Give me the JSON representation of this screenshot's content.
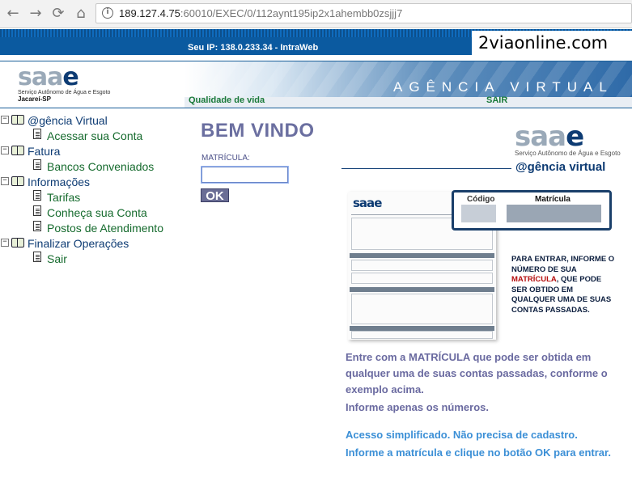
{
  "browser": {
    "url_host": "189.127.4.75",
    "url_rest": ":60010/EXEC/0/112aynt195ip2x1ahembb0zsjjj7",
    "back_icon": "←",
    "forward_icon": "→",
    "reload_icon": "⟳",
    "home_icon": "⌂"
  },
  "header": {
    "ip_text": "Seu IP: 138.0.233.34 - IntraWeb",
    "watermark": "2viaonline.com",
    "logo_word_s": "saa",
    "logo_word_e": "e",
    "logo_sub": "Serviço Autônomo de Água e Esgoto",
    "logo_city": "Jacareí-SP",
    "agencia_title": "AGÊNCIA VIRTUAL",
    "slogan": "Qualidade de vida",
    "sair_link": "SAIR"
  },
  "menu": {
    "toggle_symbol": "−",
    "groups": [
      {
        "label": "@gência Virtual",
        "items": [
          "Acessar sua Conta"
        ]
      },
      {
        "label": "Fatura",
        "items": [
          "Bancos Conveniados"
        ]
      },
      {
        "label": "Informações",
        "items": [
          "Tarifas",
          "Conheça sua Conta",
          "Postos de Atendimento"
        ]
      },
      {
        "label": "Finalizar Operações",
        "items": [
          "Sair"
        ]
      }
    ]
  },
  "login": {
    "title": "BEM VINDO",
    "label": "MATRÍCULA:",
    "input_value": "",
    "ok_label": "OK"
  },
  "right": {
    "logo_sub": "Serviço Autônomo de Água e Esgoto",
    "agencia_virtual": "@gência virtual",
    "callout_codigo": "Código",
    "callout_matricula": "Matrícula",
    "para_entrar_1": "PARA ENTRAR, INFORME O NÚMERO DE SUA ",
    "para_entrar_red": "MATRÍCULA",
    "para_entrar_2": ", QUE PODE SER OBTIDO EM QUALQUER UMA DE SUAS CONTAS PASSADAS.",
    "info_1": "Entre com a MATRÍCULA que pode ser obtida em qualquer uma de suas contas passadas, conforme o exemplo acima.",
    "info_2": "Informe apenas os números.",
    "info_3": "Acesso simplificado. Não precisa de cadastro.",
    "info_4": "Informe a matrícula e clique no botão OK para entrar."
  }
}
